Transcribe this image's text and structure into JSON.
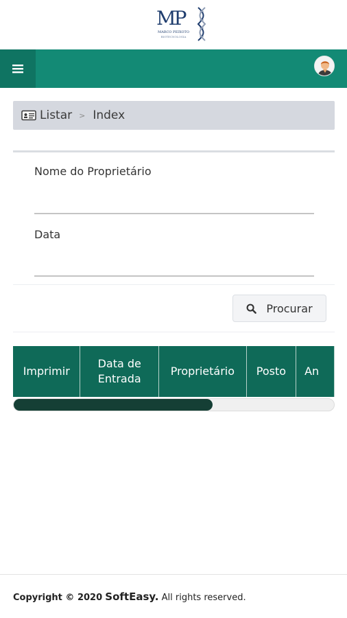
{
  "logo": {
    "letters": "MP",
    "name": "MARCO PEIXOTO",
    "tagline": "BIOTECNOLOGIA",
    "icon": "dna-helix-icon"
  },
  "topnav": {
    "menu_icon": "hamburger-icon",
    "avatar_icon": "user-avatar-icon",
    "color": "#138a75"
  },
  "breadcrumb": {
    "icon": "id-card-icon",
    "items": [
      "Listar",
      "Index"
    ],
    "separator": ">"
  },
  "filters": {
    "owner": {
      "label": "Nome do Proprietário",
      "value": "",
      "placeholder": ""
    },
    "date": {
      "label": "Data",
      "value": "",
      "placeholder": ""
    },
    "search_button": {
      "label": "Procurar",
      "icon": "search-icon"
    }
  },
  "table": {
    "header_color": "#0f6a58",
    "columns": [
      "Imprimir",
      "Data de Entrada",
      "Proprietário",
      "Posto",
      "An"
    ],
    "scroll_fraction": 0.62
  },
  "footer": {
    "prefix": "Copyright © 2020",
    "brand": "SoftEasy.",
    "suffix": "All rights reserved."
  }
}
